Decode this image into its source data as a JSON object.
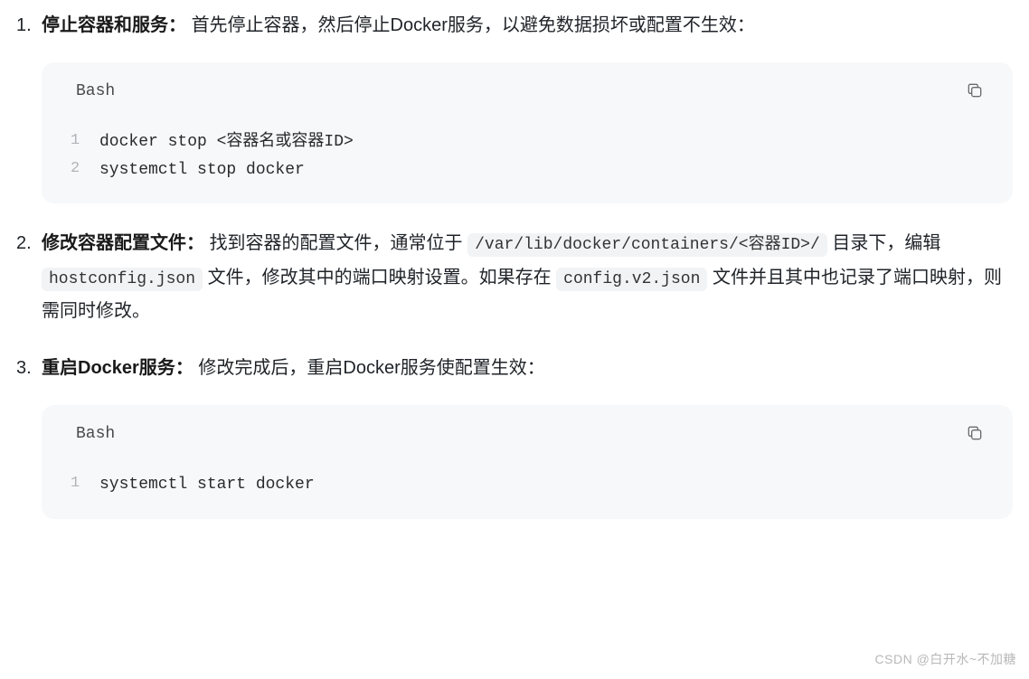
{
  "steps": [
    {
      "title": "停止容器和服务",
      "desc_plain": "首先停止容器，然后停止Docker服务，以避免数据损坏或配置不生效：",
      "code": {
        "lang": "Bash",
        "lines": [
          "docker stop <容器名或容器ID>",
          "systemctl stop docker"
        ]
      }
    },
    {
      "title": "修改容器配置文件",
      "parts": {
        "p1": "找到容器的配置文件，通常位于 ",
        "code1": "/var/lib/docker/containers/<容器ID>/",
        "p2": " 目录下，编辑 ",
        "code2": "hostconfig.json",
        "p3": " 文件，修改其中的端口映射设置。如果存在 ",
        "code3": "config.v2.json",
        "p4": " 文件并且其中也记录了端口映射，则需同时修改。"
      }
    },
    {
      "title": "重启Docker服务",
      "desc_plain": "修改完成后，重启Docker服务使配置生效：",
      "code": {
        "lang": "Bash",
        "lines": [
          "systemctl start docker"
        ]
      }
    }
  ],
  "watermark": "CSDN @白开水~不加糖"
}
